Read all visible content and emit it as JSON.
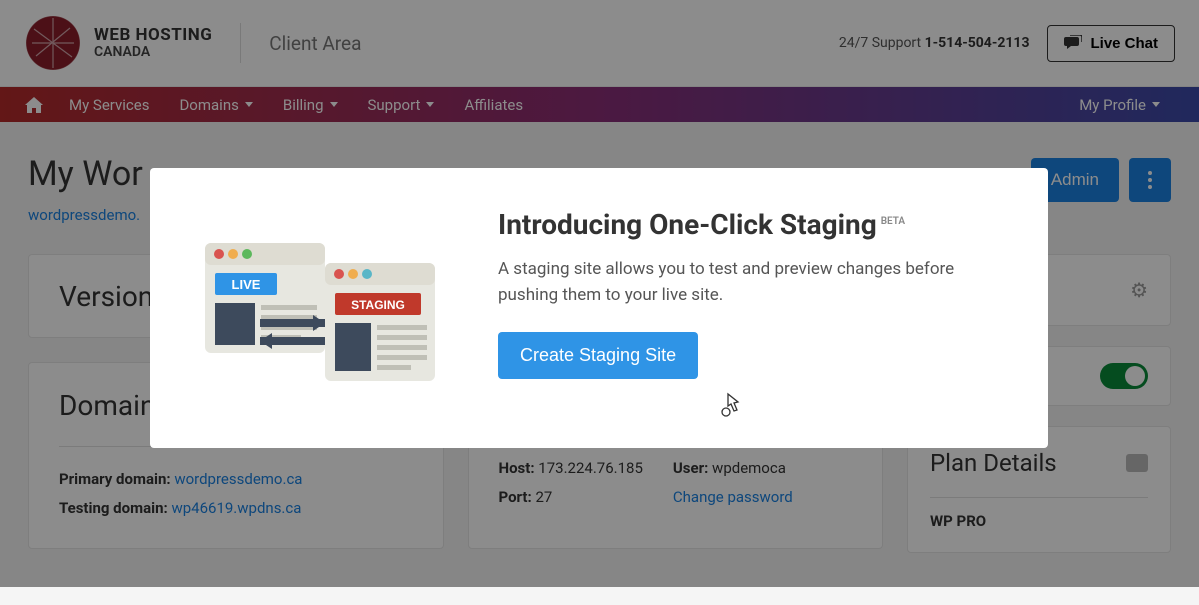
{
  "header": {
    "brand_line1": "WEB HOSTING",
    "brand_line2": "CANADA",
    "client_area": "Client Area",
    "support_prefix": "24/7 Support ",
    "support_phone": "1-514-504-2113",
    "live_chat": "Live Chat"
  },
  "nav": {
    "home": "",
    "my_services": "My Services",
    "domains": "Domains",
    "billing": "Billing",
    "support": "Support",
    "affiliates": "Affiliates",
    "my_profile": "My Profile"
  },
  "page": {
    "title": "My Wor",
    "admin_btn": "Admin",
    "domain_link": "wordpressdemo."
  },
  "version_card": {
    "title": "Version:"
  },
  "domain_card": {
    "title": "Domain",
    "primary_label": "Primary domain: ",
    "primary_value": "wordpressdemo.ca",
    "testing_label": "Testing domain: ",
    "testing_value": "wp46619.wpdns.ca"
  },
  "conn_card": {
    "host_label": "Host: ",
    "host_value": "173.224.76.185",
    "port_label": "Port: ",
    "port_value": "27",
    "user_label": "User: ",
    "user_value": "wpdemoca",
    "change_password": "Change password"
  },
  "plan_card": {
    "title": "Plan Details",
    "name": "WP PRO"
  },
  "modal": {
    "title": "Introducing One-Click Staging",
    "badge": "BETA",
    "body": "A staging site allows you to test and preview changes before pushing them to your live site.",
    "cta": "Create Staging Site",
    "illus_live": "LIVE",
    "illus_staging": "STAGING"
  }
}
